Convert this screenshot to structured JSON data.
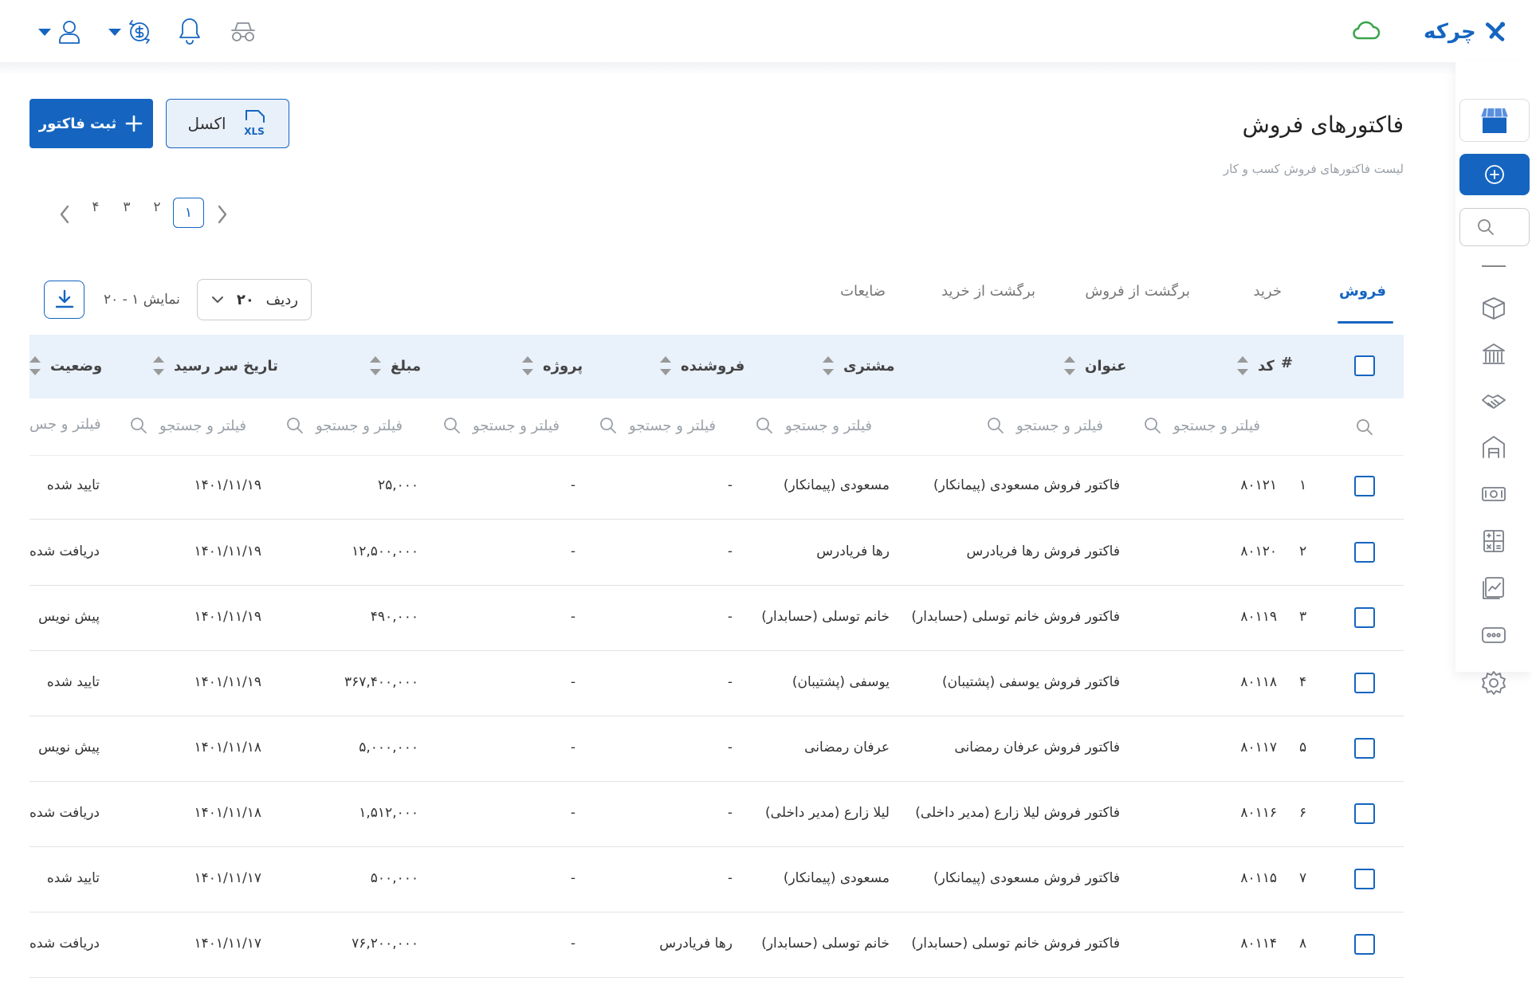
{
  "brand": {
    "logo_text": "چرکه",
    "color": "#1565c0"
  },
  "colors": {
    "accent": "#1565c0",
    "cloud": "#3aa34a",
    "header_bg": "#e9f1fb"
  },
  "header_icons": [
    "user-icon",
    "currency-icon",
    "bell-icon",
    "glasses-icon",
    "cloud-icon"
  ],
  "sidebar_icons": [
    "store-icon",
    "add-circle-icon",
    "search-icon",
    "minus-icon",
    "box-icon",
    "bank-icon",
    "handshake-icon",
    "warehouse-icon",
    "money-icon",
    "calculator-icon",
    "report-icon",
    "more-icon",
    "gear-icon"
  ],
  "page": {
    "title": "فاکتورهای فروش",
    "subtitle": "لیست فاکتورهای فروش کسب و کار"
  },
  "toolbar": {
    "add_invoice": "ثبت فاکتور",
    "excel": "اکسل",
    "excel_badge": "XLS"
  },
  "pagination": {
    "pages": [
      "۱",
      "۲",
      "۳",
      "۴"
    ],
    "current": "۱"
  },
  "tabs": [
    {
      "label": "فروش",
      "active": true
    },
    {
      "label": "خرید",
      "active": false
    },
    {
      "label": "برگشت از فروش",
      "active": false
    },
    {
      "label": "برگشت از خرید",
      "active": false
    },
    {
      "label": "ضایعات",
      "active": false
    }
  ],
  "table_controls": {
    "rows_label": "ردیف",
    "rows_value": "۲۰",
    "range_text": "نمایش ۱ - ۲۰"
  },
  "columns": [
    "#",
    "کد",
    "عنوان",
    "مشتری",
    "فروشنده",
    "پروژه",
    "مبلغ",
    "تاریخ سر رسید",
    "وضعیت"
  ],
  "filter_placeholder": "فیلتر و جستجو",
  "filter_placeholder_cut": "فیلتر و جس",
  "rows": [
    {
      "num": "۱",
      "code": "۸۰۱۲۱",
      "title": "فاکتور فروش مسعودی (پیمانکار)",
      "customer": "مسعودی (پیمانکار)",
      "seller": "-",
      "project": "-",
      "amount": "۲۵,۰۰۰",
      "due": "۱۴۰۱/۱۱/۱۹",
      "status": "تایید شده"
    },
    {
      "num": "۲",
      "code": "۸۰۱۲۰",
      "title": "فاکتور فروش رها فریادرس",
      "customer": "رها فریادرس",
      "seller": "-",
      "project": "-",
      "amount": "۱۲,۵۰۰,۰۰۰",
      "due": "۱۴۰۱/۱۱/۱۹",
      "status": "دریافت شده"
    },
    {
      "num": "۳",
      "code": "۸۰۱۱۹",
      "title": "فاکتور فروش خانم توسلی (حسابدار)",
      "customer": "خانم توسلی (حسابدار)",
      "seller": "-",
      "project": "-",
      "amount": "۴۹۰,۰۰۰",
      "due": "۱۴۰۱/۱۱/۱۹",
      "status": "پیش نویس"
    },
    {
      "num": "۴",
      "code": "۸۰۱۱۸",
      "title": "فاکتور فروش یوسفی (پشتیبان)",
      "customer": "یوسفی (پشتیبان)",
      "seller": "-",
      "project": "-",
      "amount": "۳۶۷,۴۰۰,۰۰۰",
      "due": "۱۴۰۱/۱۱/۱۹",
      "status": "تایید شده"
    },
    {
      "num": "۵",
      "code": "۸۰۱۱۷",
      "title": "فاکتور فروش عرفان رمضانی",
      "customer": "عرفان رمضانی",
      "seller": "-",
      "project": "-",
      "amount": "۵,۰۰۰,۰۰۰",
      "due": "۱۴۰۱/۱۱/۱۸",
      "status": "پیش نویس"
    },
    {
      "num": "۶",
      "code": "۸۰۱۱۶",
      "title": "فاکتور فروش لیلا زارع (مدیر داخلی)",
      "customer": "لیلا زارع (مدیر داخلی)",
      "seller": "-",
      "project": "-",
      "amount": "۱,۵۱۲,۰۰۰",
      "due": "۱۴۰۱/۱۱/۱۸",
      "status": "دریافت شده"
    },
    {
      "num": "۷",
      "code": "۸۰۱۱۵",
      "title": "فاکتور فروش مسعودی (پیمانکار)",
      "customer": "مسعودی (پیمانکار)",
      "seller": "-",
      "project": "-",
      "amount": "۵۰۰,۰۰۰",
      "due": "۱۴۰۱/۱۱/۱۷",
      "status": "تایید شده"
    },
    {
      "num": "۸",
      "code": "۸۰۱۱۴",
      "title": "فاکتور فروش خانم توسلی (حسابدار)",
      "customer": "خانم توسلی (حسابدار)",
      "seller": "رها فریادرس",
      "project": "-",
      "amount": "۷۶,۲۰۰,۰۰۰",
      "due": "۱۴۰۱/۱۱/۱۷",
      "status": "دریافت شده"
    }
  ]
}
